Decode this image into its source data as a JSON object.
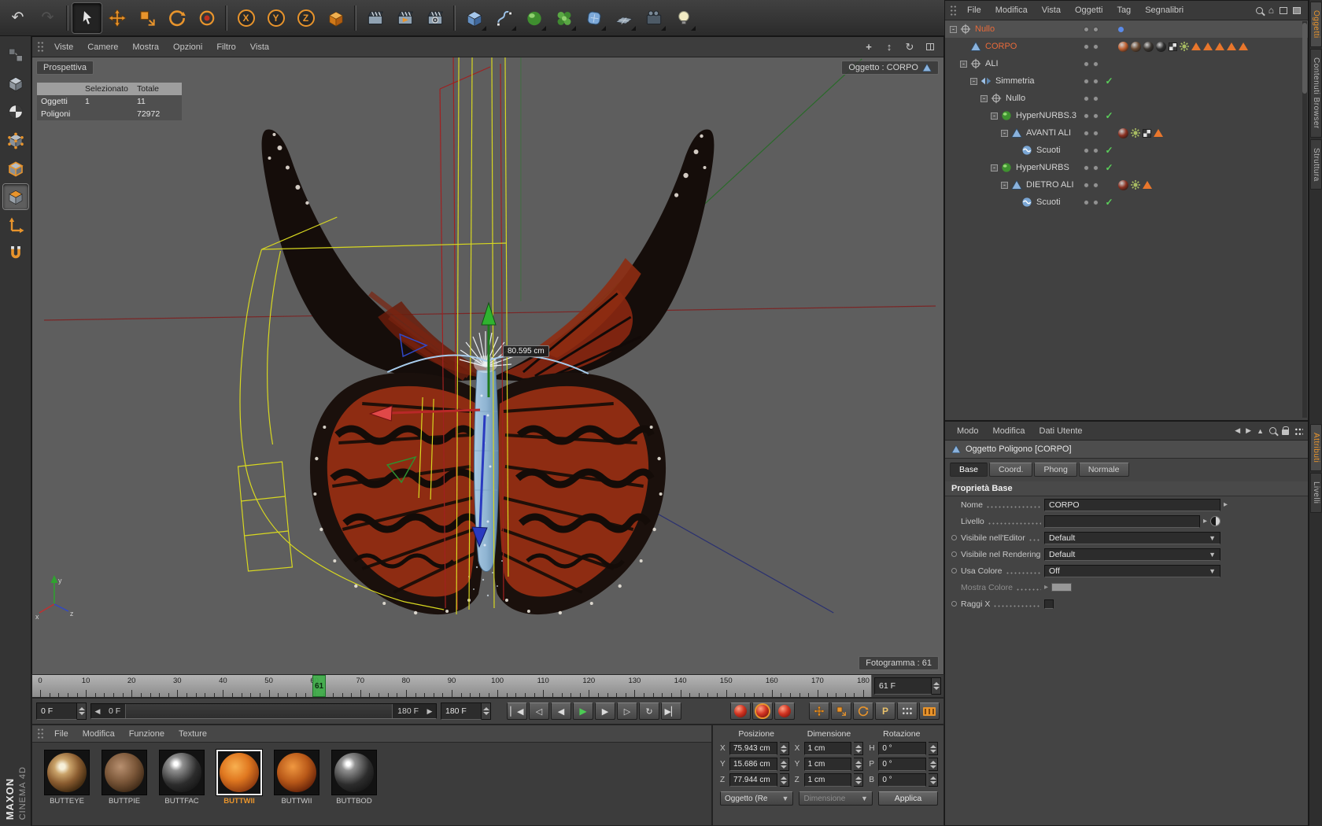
{
  "app": {
    "brand_line1": "MAXON",
    "brand_line2": "CINEMA 4D"
  },
  "main_toolbar": {
    "groups": [
      {
        "name": "history",
        "items": [
          {
            "name": "undo",
            "icon": "undo"
          },
          {
            "name": "redo",
            "icon": "redo",
            "disabled": true
          }
        ]
      },
      {
        "name": "tools",
        "items": [
          {
            "name": "live-selection",
            "icon": "cursor",
            "active": true
          },
          {
            "name": "move",
            "icon": "move"
          },
          {
            "name": "scale",
            "icon": "scale"
          },
          {
            "name": "rotate",
            "icon": "rotate"
          },
          {
            "name": "last-tool",
            "icon": "lasttool"
          }
        ]
      },
      {
        "name": "axis-locks",
        "items": [
          {
            "name": "lock-x",
            "icon": "lock",
            "letter": "X"
          },
          {
            "name": "lock-y",
            "icon": "lock",
            "letter": "Y"
          },
          {
            "name": "lock-z",
            "icon": "lock",
            "letter": "Z"
          },
          {
            "name": "coordinate-system",
            "icon": "coordcube"
          }
        ]
      },
      {
        "name": "render",
        "items": [
          {
            "name": "render-view",
            "icon": "clap"
          },
          {
            "name": "render-active-objects",
            "icon": "clap2"
          },
          {
            "name": "render-settings",
            "icon": "clap3"
          }
        ]
      },
      {
        "name": "create",
        "items": [
          {
            "name": "add-primitive-cube",
            "icon": "objcube",
            "flyout": true
          },
          {
            "name": "add-spline",
            "icon": "spline",
            "flyout": true
          },
          {
            "name": "add-hypernurbs",
            "icon": "nurbs",
            "flyout": true
          },
          {
            "name": "add-array",
            "icon": "flower",
            "flyout": true
          },
          {
            "name": "add-deformer",
            "icon": "deform",
            "flyout": true
          },
          {
            "name": "add-floor",
            "icon": "floor",
            "flyout": true
          },
          {
            "name": "add-stage",
            "icon": "stage",
            "flyout": true
          },
          {
            "name": "add-light",
            "icon": "bulb",
            "flyout": true
          }
        ]
      }
    ]
  },
  "mode_toolbar": {
    "items": [
      {
        "name": "make-editable",
        "icon": "editable",
        "disabled": true
      },
      {
        "name": "model-mode",
        "icon": "modelmode"
      },
      {
        "name": "texture-mode",
        "icon": "texmode"
      },
      {
        "name": "points-mode",
        "icon": "points"
      },
      {
        "name": "edges-mode",
        "icon": "edges"
      },
      {
        "name": "polygons-mode",
        "icon": "polys",
        "active": true
      },
      {
        "name": "object-axis-mode",
        "icon": "axis"
      },
      {
        "name": "snap-magnet",
        "icon": "magnet"
      }
    ]
  },
  "viewport": {
    "menu": [
      "Viste",
      "Camere",
      "Mostra",
      "Opzioni",
      "Filtro",
      "Vista"
    ],
    "view_label": "Prospettiva",
    "object_badge": "Oggetto : CORPO",
    "frame_badge": "Fotogramma : 61",
    "measure_label": "80.595 cm",
    "hud": {
      "header_selected": "Selezionato",
      "header_total": "Totale",
      "rows": [
        {
          "label": "Oggetti",
          "selected": "1",
          "total": "11"
        },
        {
          "label": "Poligoni",
          "selected": "",
          "total": "72972"
        }
      ]
    },
    "axis_triad": {
      "x": "x",
      "y": "y",
      "z": "z"
    }
  },
  "timeline": {
    "start": 0,
    "end": 180,
    "label_step": 10,
    "current": 61,
    "current_label": "61",
    "tick_labels": [
      "0",
      "10",
      "20",
      "30",
      "40",
      "50",
      "60",
      "70",
      "80",
      "90",
      "100",
      "110",
      "120",
      "130",
      "140",
      "150",
      "160",
      "170",
      "180"
    ],
    "frame_field": "61 F",
    "loop_start_field": "0 F",
    "loop_end_field": "180 F",
    "range_left_label": "0 F",
    "range_right_label": "180 F"
  },
  "transport": {
    "buttons": [
      {
        "name": "goto-start",
        "glyph": "▏◀"
      },
      {
        "name": "prev-key",
        "glyph": "◁"
      },
      {
        "name": "prev-frame",
        "glyph": "◀"
      },
      {
        "name": "play",
        "glyph": "▶",
        "accent": true
      },
      {
        "name": "next-frame",
        "glyph": "▶"
      },
      {
        "name": "next-key",
        "glyph": "▷"
      },
      {
        "name": "loop",
        "glyph": "↻"
      },
      {
        "name": "goto-end",
        "glyph": "▶▏"
      }
    ],
    "record_buttons": [
      {
        "name": "record-keyframe"
      },
      {
        "name": "autokeying"
      },
      {
        "name": "record-options"
      }
    ],
    "record_toggles": [
      {
        "name": "record-position",
        "icon": "move"
      },
      {
        "name": "record-scale",
        "icon": "scale"
      },
      {
        "name": "record-rotation",
        "icon": "rotate"
      },
      {
        "name": "record-parameter",
        "icon": "letter",
        "letter": "P"
      },
      {
        "name": "record-point-level",
        "icon": "dots"
      },
      {
        "name": "keyframe-edit",
        "icon": "film"
      }
    ]
  },
  "materials": {
    "menu": [
      "File",
      "Modifica",
      "Funzione",
      "Texture"
    ],
    "items": [
      {
        "label": "BUTTEYE",
        "kind": "eye"
      },
      {
        "label": "BUTTPIE",
        "kind": "fur"
      },
      {
        "label": "BUTTFAC",
        "kind": "gloss"
      },
      {
        "label": "BUTTWII",
        "kind": "wing",
        "selected": true
      },
      {
        "label": "BUTTWII",
        "kind": "wing2"
      },
      {
        "label": "BUTTBOD",
        "kind": "gloss"
      }
    ]
  },
  "coordinates": {
    "headers": [
      "Posizione",
      "Dimensione",
      "Rotazione"
    ],
    "position": [
      {
        "axis": "X",
        "value": "75.943 cm"
      },
      {
        "axis": "Y",
        "value": "15.686 cm"
      },
      {
        "axis": "Z",
        "value": "77.944 cm"
      }
    ],
    "size": [
      {
        "axis": "X",
        "value": "1 cm"
      },
      {
        "axis": "Y",
        "value": "1 cm"
      },
      {
        "axis": "Z",
        "value": "1 cm"
      }
    ],
    "rotation": [
      {
        "axis": "H",
        "value": "0 °"
      },
      {
        "axis": "P",
        "value": "0 °"
      },
      {
        "axis": "B",
        "value": "0 °"
      }
    ],
    "mode_select": "Oggetto (Re",
    "size_select": "Dimensione",
    "apply_label": "Applica"
  },
  "object_manager": {
    "menu": [
      "File",
      "Modifica",
      "Vista",
      "Oggetti",
      "Tag",
      "Segnalibri"
    ],
    "items": [
      {
        "label": "Nullo",
        "depth": 0,
        "icon": "null",
        "expand": true,
        "selected": true,
        "highlight": true,
        "tags": [
          {
            "type": "dot-blue"
          }
        ]
      },
      {
        "label": "CORPO",
        "depth": 1,
        "icon": "poly",
        "selected": true,
        "tags": [
          {
            "type": "ball",
            "c": "#c06030"
          },
          {
            "type": "ball",
            "c": "#6a4a32"
          },
          {
            "type": "ball",
            "c": "#3a3530"
          },
          {
            "type": "ball",
            "c": "#2e2e2e"
          },
          {
            "type": "checker"
          },
          {
            "type": "gear"
          },
          {
            "type": "tri"
          },
          {
            "type": "tri"
          },
          {
            "type": "tri"
          },
          {
            "type": "tri"
          },
          {
            "type": "tri"
          }
        ]
      },
      {
        "label": "ALI",
        "depth": 1,
        "icon": "null",
        "expand": true,
        "tags": []
      },
      {
        "label": "Simmetria",
        "depth": 2,
        "icon": "symmetry",
        "expand": true,
        "check": true,
        "tags": []
      },
      {
        "label": "Nullo",
        "depth": 3,
        "icon": "null",
        "expand": true,
        "tags": []
      },
      {
        "label": "HyperNURBS.3",
        "depth": 4,
        "icon": "hnurbs",
        "expand": true,
        "check": true,
        "tags": []
      },
      {
        "label": "AVANTI ALI",
        "depth": 5,
        "icon": "poly",
        "expand": true,
        "tags": [
          {
            "type": "ball",
            "c": "#8a3020"
          },
          {
            "type": "gear"
          },
          {
            "type": "checker"
          },
          {
            "type": "tri"
          }
        ]
      },
      {
        "label": "Scuoti",
        "depth": 6,
        "icon": "scuoti",
        "check": true,
        "tags": []
      },
      {
        "label": "HyperNURBS",
        "depth": 4,
        "icon": "hnurbs",
        "expand": true,
        "check": true,
        "tags": []
      },
      {
        "label": "DIETRO ALI",
        "depth": 5,
        "icon": "poly",
        "expand": true,
        "tags": [
          {
            "type": "ball",
            "c": "#8a3020"
          },
          {
            "type": "gear"
          },
          {
            "type": "tri"
          }
        ]
      },
      {
        "label": "Scuoti",
        "depth": 6,
        "icon": "scuoti",
        "check": true,
        "tags": []
      }
    ]
  },
  "attributes": {
    "menu": [
      "Modo",
      "Modifica",
      "Dati Utente"
    ],
    "title": "Oggetto Poligono [CORPO]",
    "tabs": [
      {
        "label": "Base",
        "active": true
      },
      {
        "label": "Coord."
      },
      {
        "label": "Phong"
      },
      {
        "label": "Normale"
      }
    ],
    "section": "Proprietà Base",
    "rows": [
      {
        "label": "Nome",
        "control": "text",
        "value": "CORPO"
      },
      {
        "label": "Livello",
        "control": "layer"
      },
      {
        "label": "Visibile nell'Editor",
        "control": "select",
        "value": "Default",
        "dot": true
      },
      {
        "label": "Visibile nel Rendering",
        "control": "select",
        "value": "Default",
        "dot": true
      },
      {
        "label": "Usa Colore",
        "control": "select",
        "value": "Off",
        "dot": true
      },
      {
        "label": "Mostra Colore",
        "control": "swatch",
        "disabled": true
      },
      {
        "label": "Raggi X",
        "control": "checkbox",
        "dot": true
      }
    ]
  },
  "side_tabs": {
    "top": [
      {
        "label": "Oggetti",
        "active": true
      },
      {
        "label": "Contenuti Browser"
      },
      {
        "label": "Struttura"
      }
    ],
    "bottom": [
      {
        "label": "Attributi",
        "active": true
      },
      {
        "label": "Livelli"
      }
    ]
  }
}
